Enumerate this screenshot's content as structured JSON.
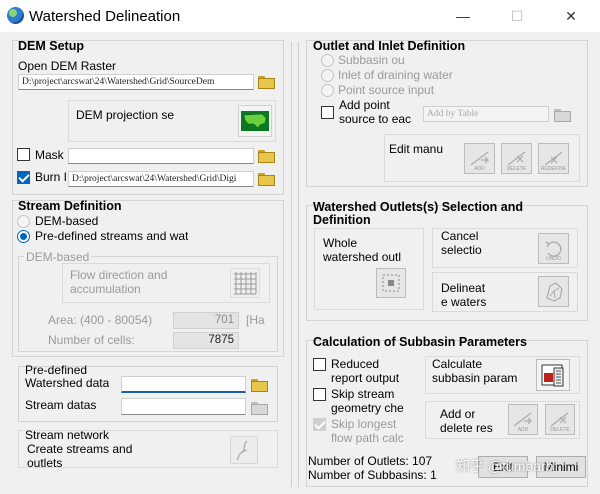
{
  "window": {
    "title": "Watershed Delineation",
    "minimize_glyph": "—",
    "maximize_glyph": "☐",
    "close_glyph": "✕"
  },
  "dem_setup": {
    "title": "DEM Setup",
    "open_dem_label": "Open DEM Raster",
    "dem_path": "D:\\project\\arcswat\\24\\Watershed\\Grid\\SourceDem",
    "projection_label": "DEM projection se",
    "mask_label": "Mask",
    "mask_checked": false,
    "burn_label": "Burn I",
    "burn_checked": true,
    "burn_path": "D:\\project\\arcswat\\24\\Watershed\\Grid\\Digi"
  },
  "stream_definition": {
    "title": "Stream Definition",
    "dem_based_label": "DEM-based",
    "predefined_label": "Pre-defined  streams  and wat",
    "selected": "predefined",
    "dem_based_group_label": "DEM-based",
    "flow_direction_label_1": "Flow direction and",
    "flow_direction_label_2": "accumulation",
    "area_label": "Area: (400 - 80054)",
    "area_value": "701",
    "area_unit": "[Ha",
    "cells_label": "Number of cells:",
    "cells_value": "7875"
  },
  "predefined": {
    "title": "Pre-defined",
    "watershed_label": "Watershed data",
    "watershed_value": "",
    "stream_label": "Stream datas",
    "stream_value": ""
  },
  "stream_network": {
    "title": "Stream network",
    "line1": "Create streams and",
    "line2": "outlets"
  },
  "outlet_inlet": {
    "title": "Outlet and Inlet Definition",
    "subbasin_label": "Subbasin ou",
    "inlet_label": "Inlet of draining water",
    "point_source_label": "Point source input",
    "add_point_label_1": "Add point",
    "add_point_label_2": "source to eac",
    "add_by_table": "Add by Table",
    "edit_manual_label": "Edit manu",
    "edit_icons": [
      "ADD",
      "DELETE",
      "REDEFINE"
    ]
  },
  "outlets_selection": {
    "title_1": "Watershed Outlets(s) Selection and",
    "title_2": "Definition",
    "whole_watershed_1": "Whole",
    "whole_watershed_2": "watershed outl",
    "cancel_1": "Cancel",
    "cancel_2": "selectio",
    "cancel_icon_cap": "UNDO",
    "delineate_1": "Delineat",
    "delineate_2": "e waters"
  },
  "subbasin_params": {
    "title": "Calculation of Subbasin Parameters",
    "reduced_1": "Reduced",
    "reduced_2": "report output",
    "skip_stream_1": "Skip stream",
    "skip_stream_2": "geometry che",
    "skip_longest_1": "Skip longest",
    "skip_longest_2": "flow path calc",
    "calculate_1": "Calculate",
    "calculate_2": "subbasin param",
    "add_delete_1": "Add or",
    "add_delete_2": "delete res",
    "add_delete_icons": [
      "ADD",
      "DELETE"
    ]
  },
  "status": {
    "outlets": "Number of Outlets: 107",
    "subbasins": "Number of Subbasins: 1"
  },
  "buttons": {
    "exit": "Exit",
    "minimize": "Minimi"
  },
  "watermark": "知乎 @tumbarb"
}
